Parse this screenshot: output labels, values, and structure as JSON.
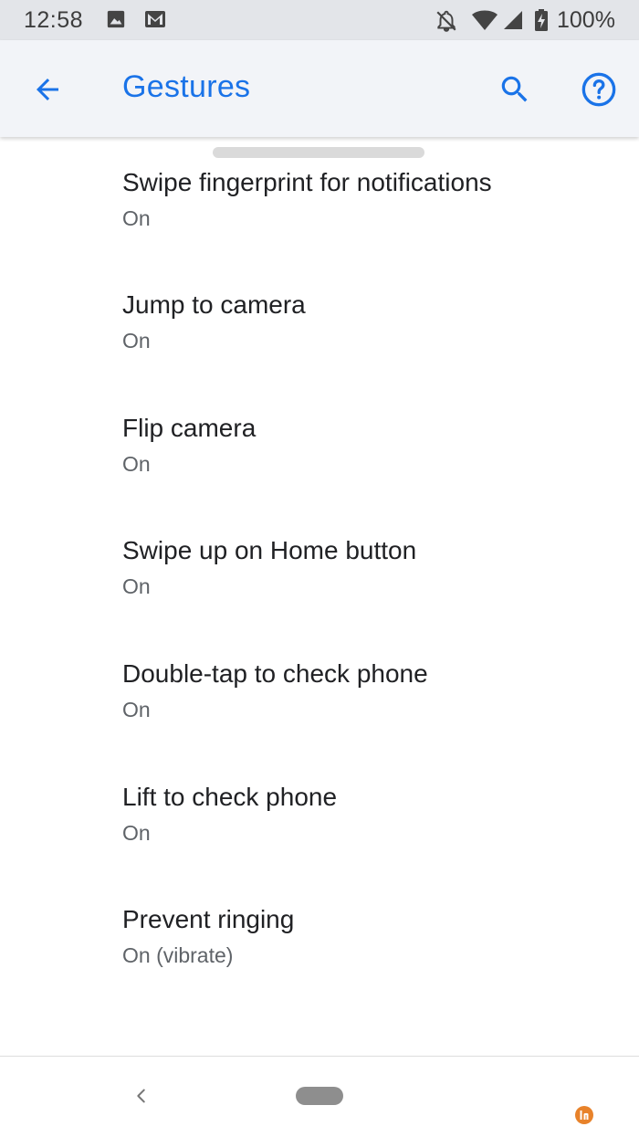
{
  "status_bar": {
    "time": "12:58",
    "battery_text": "100%",
    "icons": [
      "image-icon",
      "gmail-icon",
      "notifications-off-icon",
      "wifi-icon",
      "signal-icon",
      "battery-charging-icon"
    ]
  },
  "app_bar": {
    "title": "Gestures",
    "back_icon": "arrow-back-icon",
    "search_icon": "search-icon",
    "help_icon": "help-icon"
  },
  "settings": {
    "items": [
      {
        "title": "Swipe fingerprint for notifications",
        "summary": "On"
      },
      {
        "title": "Jump to camera",
        "summary": "On"
      },
      {
        "title": "Flip camera",
        "summary": "On"
      },
      {
        "title": "Swipe up on Home button",
        "summary": "On"
      },
      {
        "title": "Double-tap to check phone",
        "summary": "On"
      },
      {
        "title": "Lift to check phone",
        "summary": "On"
      },
      {
        "title": "Prevent ringing",
        "summary": "On (vibrate)"
      }
    ]
  },
  "nav_bar": {
    "back_icon": "chevron-left-icon",
    "home_icon": "home-pill-icon"
  },
  "colors": {
    "accent": "#1a73e8",
    "status_bar_bg": "#e3e5e9",
    "app_bar_bg": "#f2f4f8",
    "title_text": "#202124",
    "summary_text": "#5f6368",
    "watermark": "#e8822a"
  }
}
